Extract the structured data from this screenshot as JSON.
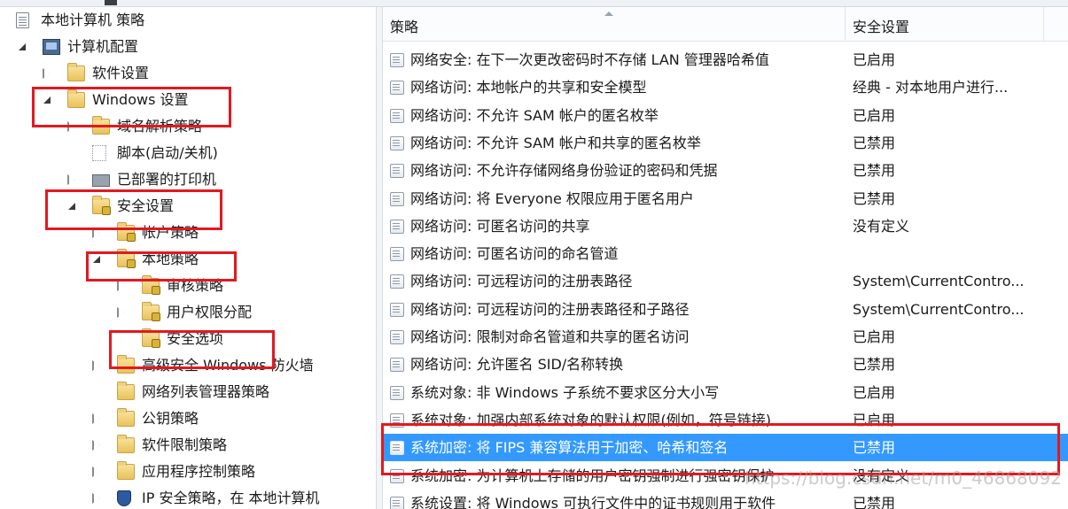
{
  "tree": {
    "items": [
      {
        "label": "本地计算机 策略",
        "arrow": "none",
        "icon": "doc"
      },
      {
        "label": "计算机配置",
        "arrow": "expanded",
        "icon": "pc"
      },
      {
        "label": "软件设置",
        "arrow": "collapsed",
        "icon": "folder"
      },
      {
        "label": "Windows 设置",
        "arrow": "expanded",
        "icon": "folder"
      },
      {
        "label": "域名解析策略",
        "arrow": "collapsed",
        "icon": "folder"
      },
      {
        "label": "脚本(启动/关机)",
        "arrow": "none",
        "icon": "script"
      },
      {
        "label": "已部署的打印机",
        "arrow": "collapsed",
        "icon": "printer"
      },
      {
        "label": "安全设置",
        "arrow": "expanded",
        "icon": "lockfolder"
      },
      {
        "label": "帐户策略",
        "arrow": "collapsed",
        "icon": "lockfolder"
      },
      {
        "label": "本地策略",
        "arrow": "expanded",
        "icon": "lockfolder"
      },
      {
        "label": "审核策略",
        "arrow": "collapsed",
        "icon": "lockfolder"
      },
      {
        "label": "用户权限分配",
        "arrow": "collapsed",
        "icon": "lockfolder"
      },
      {
        "label": "安全选项",
        "arrow": "none",
        "icon": "lockfolder"
      },
      {
        "label": "高级安全 Windows 防火墙",
        "arrow": "collapsed",
        "icon": "folder"
      },
      {
        "label": "网络列表管理器策略",
        "arrow": "none",
        "icon": "folder"
      },
      {
        "label": "公钥策略",
        "arrow": "collapsed",
        "icon": "folder"
      },
      {
        "label": "软件限制策略",
        "arrow": "collapsed",
        "icon": "folder"
      },
      {
        "label": "应用程序控制策略",
        "arrow": "collapsed",
        "icon": "folder"
      },
      {
        "label": "IP 安全策略，在 本地计算机",
        "arrow": "collapsed",
        "icon": "shield"
      }
    ]
  },
  "list": {
    "columns": {
      "policy": "策略",
      "setting": "安全设置"
    },
    "rows": [
      {
        "policy": "网络安全: 在下一次更改密码时不存储 LAN 管理器哈希值",
        "setting": "已启用"
      },
      {
        "policy": "网络访问: 本地帐户的共享和安全模型",
        "setting": "经典 - 对本地用户进行..."
      },
      {
        "policy": "网络访问: 不允许 SAM 帐户的匿名枚举",
        "setting": "已启用"
      },
      {
        "policy": "网络访问: 不允许 SAM 帐户和共享的匿名枚举",
        "setting": "已禁用"
      },
      {
        "policy": "网络访问: 不允许存储网络身份验证的密码和凭据",
        "setting": "已禁用"
      },
      {
        "policy": "网络访问: 将 Everyone 权限应用于匿名用户",
        "setting": "已禁用"
      },
      {
        "policy": "网络访问: 可匿名访问的共享",
        "setting": "没有定义"
      },
      {
        "policy": "网络访问: 可匿名访问的命名管道",
        "setting": ""
      },
      {
        "policy": "网络访问: 可远程访问的注册表路径",
        "setting": "System\\CurrentContro..."
      },
      {
        "policy": "网络访问: 可远程访问的注册表路径和子路径",
        "setting": "System\\CurrentContro..."
      },
      {
        "policy": "网络访问: 限制对命名管道和共享的匿名访问",
        "setting": "已启用"
      },
      {
        "policy": "网络访问: 允许匿名 SID/名称转换",
        "setting": "已禁用"
      },
      {
        "policy": "系统对象: 非 Windows 子系统不要求区分大小写",
        "setting": "已启用"
      },
      {
        "policy": "系统对象: 加强内部系统对象的默认权限(例如，符号链接)",
        "setting": "已启用"
      },
      {
        "policy": "系统加密: 将 FIPS 兼容算法用于加密、哈希和签名",
        "setting": "已禁用",
        "selected": true
      },
      {
        "policy": "系统加密: 为计算机上存储的用户密钥强制进行强密钥保护",
        "setting": "没有定义"
      },
      {
        "policy": "系统设置: 将 Windows 可执行文件中的证书规则用于软件",
        "setting": "已禁用"
      }
    ]
  },
  "watermark": "https://blog.csdn.net/m0_46868092",
  "colors": {
    "selection": "#3399ff",
    "annotation": "#e2191f"
  }
}
